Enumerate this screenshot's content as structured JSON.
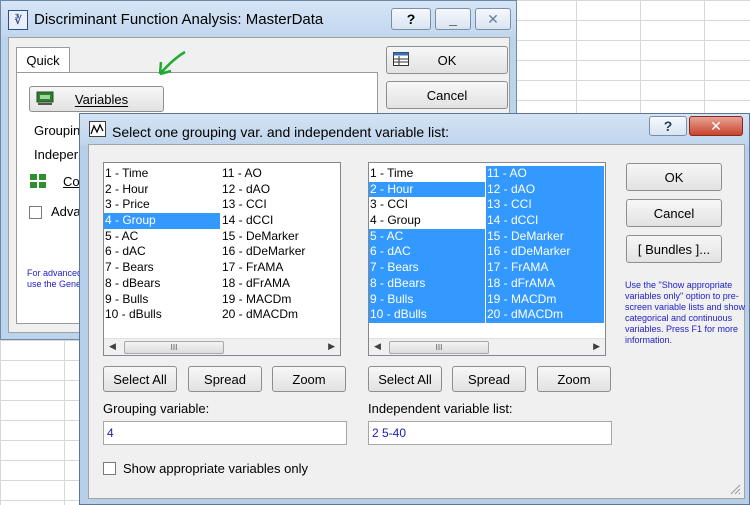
{
  "back_window": {
    "title": "Discriminant Function Analysis: MasterData",
    "title_buttons": [
      "?",
      "_",
      "✕"
    ],
    "tab": "Quick",
    "variables_button": "Variables",
    "ok_button": "OK",
    "cancel_button": "Cancel",
    "row_grouping": "Groupin",
    "row_independent": "Indeper",
    "row_code": "Co",
    "row_advanced": "Adva",
    "note_lines": [
      "For advanced",
      "use the Gene"
    ]
  },
  "dialog": {
    "title": "Select one grouping var. and independent variable list:",
    "help_button": "?",
    "close_button": "✕",
    "left_list": {
      "col1": [
        "1 - Time",
        "2 - Hour",
        "3 - Price",
        "4 - Group",
        "5 - AC",
        "6 - dAC",
        "7 - Bears",
        "8 - dBears",
        "9 - Bulls",
        "10 - dBulls"
      ],
      "col2": [
        "11 - AO",
        "12 - dAO",
        "13 - CCI",
        "14 - dCCI",
        "15 - DeMarker",
        "16 - dDeMarker",
        "17 - FrAMA",
        "18 - dFrAMA",
        "19 - MACDm",
        "20 - dMACDm"
      ]
    },
    "right_list": {
      "col1": [
        "1 - Time",
        "2 - Hour",
        "3 - CCI",
        "4 - Group",
        "5 - AC",
        "6 - dAC",
        "7 - Bears",
        "8 - dBears",
        "9 - Bulls",
        "10 - dBulls"
      ],
      "col2": [
        "11 - AO",
        "12 - dAO",
        "13 - CCI",
        "14 - dCCI",
        "15 - DeMarker",
        "16 - dDeMarker",
        "17 - FrAMA",
        "18 - dFrAMA",
        "19 - MACDm",
        "20 - dMACDm"
      ]
    },
    "scroll_thumb_label": "III",
    "select_all": "Select All",
    "spread": "Spread",
    "zoom": "Zoom",
    "grouping_label": "Grouping variable:",
    "grouping_value": "4",
    "independent_label": "Independent variable list:",
    "independent_value": "2 5-40",
    "ok_button": "OK",
    "cancel_button": "Cancel",
    "bundles_button": "[ Bundles ]...",
    "note": "Use the \"Show appropriate variables only\" option to pre-screen variable lists and show categorical and continuous variables. Press F1 for more information.",
    "show_appropriate_label": "Show appropriate variables only"
  },
  "colors": {
    "selection": "#3399ff",
    "titlebar": "#c1d6ee",
    "annotation_arrow": "#22aa33",
    "note_text": "#2020c8"
  }
}
